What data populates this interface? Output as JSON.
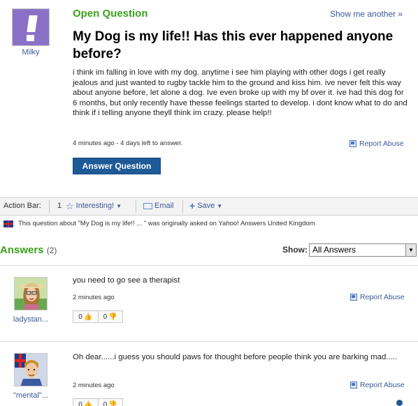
{
  "question": {
    "status": "Open Question",
    "show_another": "Show me another »",
    "asker": "Milky",
    "title": "My Dog is my life!! Has this ever happened anyone before?",
    "body": "i think im falling in love with my dog. anytime i see him playing with other dogs i get really jealous and just wanted to rugby tackle him to the ground and kiss him. ive never felt this way about anyone before, let alone a dog. Ive even broke up with my bf over it. ive had this dog for 6 months, but only recently have thesse feelings started to develop. i dont know what to do and think if i telling anyone theyll think im crazy. please help!!",
    "meta": "4 minutes ago - 4 days left to answer.",
    "report": "Report Abuse",
    "answer_button": "Answer Question"
  },
  "action_bar": {
    "label": "Action Bar:",
    "interesting_count": "1",
    "interesting": "Interesting!",
    "email": "Email",
    "save": "Save",
    "origin_note": "This question about \"My Dog is my life!! ... \" was originally asked on Yahoo! Answers United Kingdom"
  },
  "answers": {
    "heading": "Answers",
    "count": "(2)",
    "show_label": "Show:",
    "show_value": "All Answers",
    "items": [
      {
        "user": "ladystan...",
        "text": "you need to go see a therapist",
        "time": "2 minutes ago",
        "report": "Report Abuse",
        "up": "0",
        "down": "0"
      },
      {
        "user": "\"mental\"...",
        "text": "Oh dear......i guess you should paws for thought before people think you are barking mad.....",
        "time": "2 minutes ago",
        "report": "Report Abuse",
        "up": "0",
        "down": "0"
      }
    ]
  },
  "colors": {
    "green_heading": "#3aa21c",
    "link_blue": "#3b5998",
    "button_blue": "#1e5a96",
    "avatar_purple": "#8a71c8"
  }
}
